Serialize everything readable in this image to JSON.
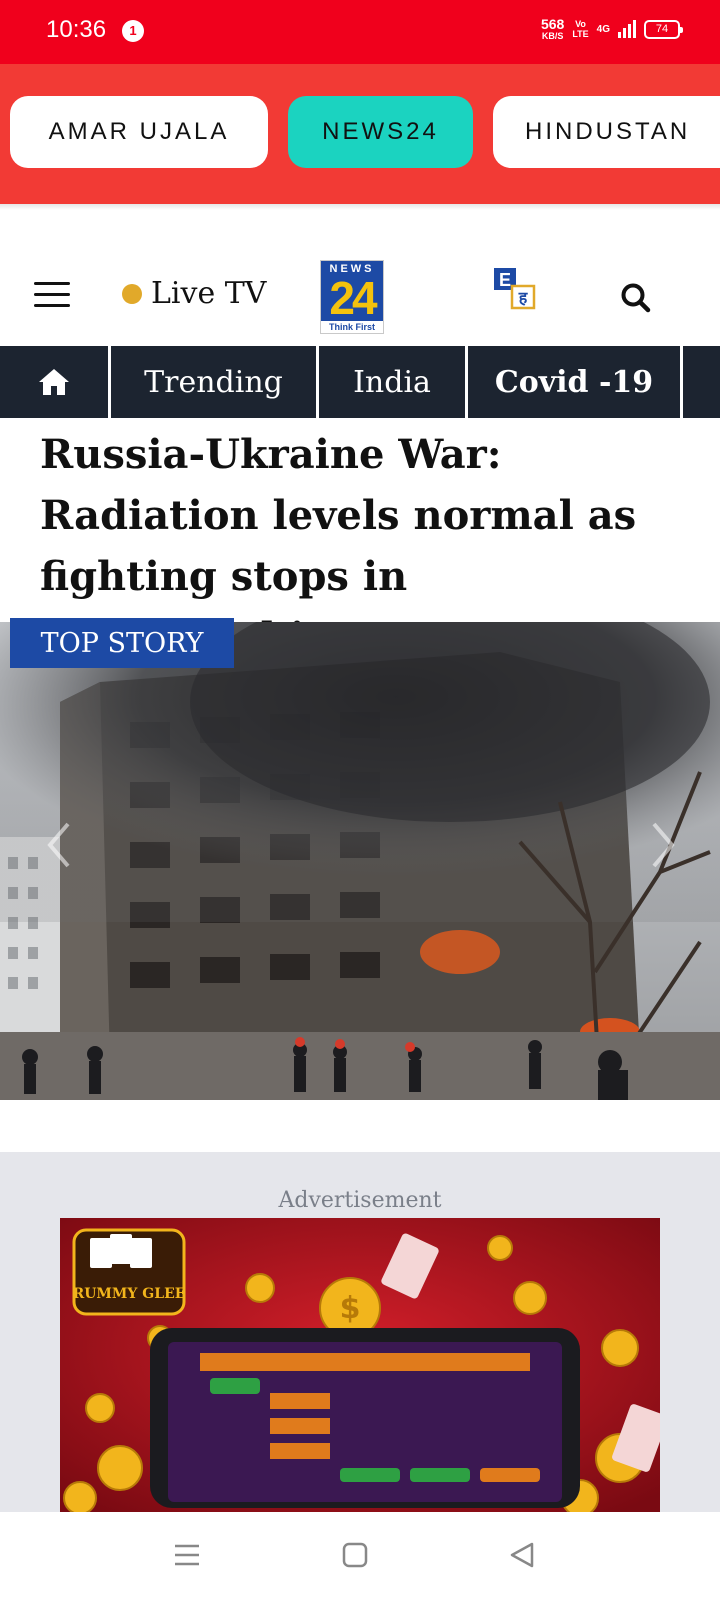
{
  "status_bar": {
    "time": "10:36",
    "notification_count": "1",
    "net_speed_value": "568",
    "net_speed_unit": "KB/S",
    "volte_top": "Vo",
    "volte_bottom": "LTE",
    "network": "4G",
    "battery": "74"
  },
  "sources": [
    {
      "label": "AMAR UJALA",
      "active": false
    },
    {
      "label": "NEWS24",
      "active": true
    },
    {
      "label": "HINDUSTAN",
      "active": false
    }
  ],
  "header": {
    "live_label": "Live TV",
    "logo_top": "NEWS",
    "logo_number": "24",
    "logo_tagline": "Think First",
    "lang_en": "E",
    "lang_hi": "ह"
  },
  "nav": {
    "items": [
      "Trending",
      "India",
      "Covid -19"
    ]
  },
  "article": {
    "headline": "Russia-Ukraine War: Radiation levels normal as fighting stops in Zaporizhzhia",
    "badge": "TOP STORY"
  },
  "ad": {
    "label": "Advertisement",
    "brand": "RUMMY GLEE"
  },
  "colors": {
    "status_bar": "#f0001c",
    "chip_bar": "#f23a35",
    "active_chip": "#1bd3c0",
    "nav_bg": "#1c2430",
    "badge": "#1d4aa5",
    "live_dot": "#e1a92a"
  }
}
